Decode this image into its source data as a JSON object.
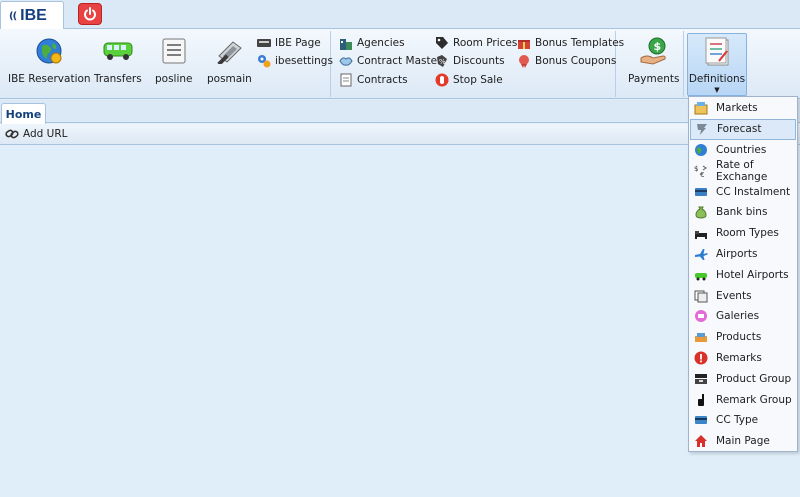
{
  "top": {
    "logo_mark": "((",
    "logo_text": "IBE"
  },
  "ribbon": {
    "ibe_reservation": "IBE Reservation",
    "transfers": "Transfers",
    "posline": "posline",
    "posmain": "posmain",
    "ibe_page": "IBE Page",
    "ibesettings": "ibesettings",
    "agencies": "Agencies",
    "contract_master": "Contract Master",
    "contracts": "Contracts",
    "room_prices": "Room Prices",
    "discounts": "Discounts",
    "stop_sale": "Stop Sale",
    "bonus_templates": "Bonus Templates",
    "bonus_coupons": "Bonus Coupons",
    "payments": "Payments",
    "definitions": "Definitions"
  },
  "tabs": {
    "home": "Home",
    "add_url": "Add URL"
  },
  "menu": {
    "active_index": 1,
    "items": [
      {
        "label": "Markets",
        "icon": "markets-icon"
      },
      {
        "label": "Forecast",
        "icon": "forecast-icon"
      },
      {
        "label": "Countries",
        "icon": "globe-icon"
      },
      {
        "label": "Rate of Exchange",
        "icon": "exchange-icon"
      },
      {
        "label": "CC Instalment",
        "icon": "credit-card-icon"
      },
      {
        "label": "Bank bins",
        "icon": "money-bag-icon"
      },
      {
        "label": "Room Types",
        "icon": "bed-icon"
      },
      {
        "label": "Airports",
        "icon": "airplane-icon"
      },
      {
        "label": "Hotel Airports",
        "icon": "shuttle-icon"
      },
      {
        "label": "Events",
        "icon": "events-icon"
      },
      {
        "label": "Galeries",
        "icon": "gallery-icon"
      },
      {
        "label": "Products",
        "icon": "products-icon"
      },
      {
        "label": "Remarks",
        "icon": "alert-icon"
      },
      {
        "label": "Product Group",
        "icon": "product-group-icon"
      },
      {
        "label": "Remark Group",
        "icon": "remark-group-icon"
      },
      {
        "label": "CC Type",
        "icon": "card-type-icon"
      },
      {
        "label": "Main Page",
        "icon": "home-icon"
      }
    ]
  },
  "colors": {
    "accent": "#15407e",
    "ribbon_bg": "#dce9f6",
    "content_bg": "#dfeef8"
  }
}
